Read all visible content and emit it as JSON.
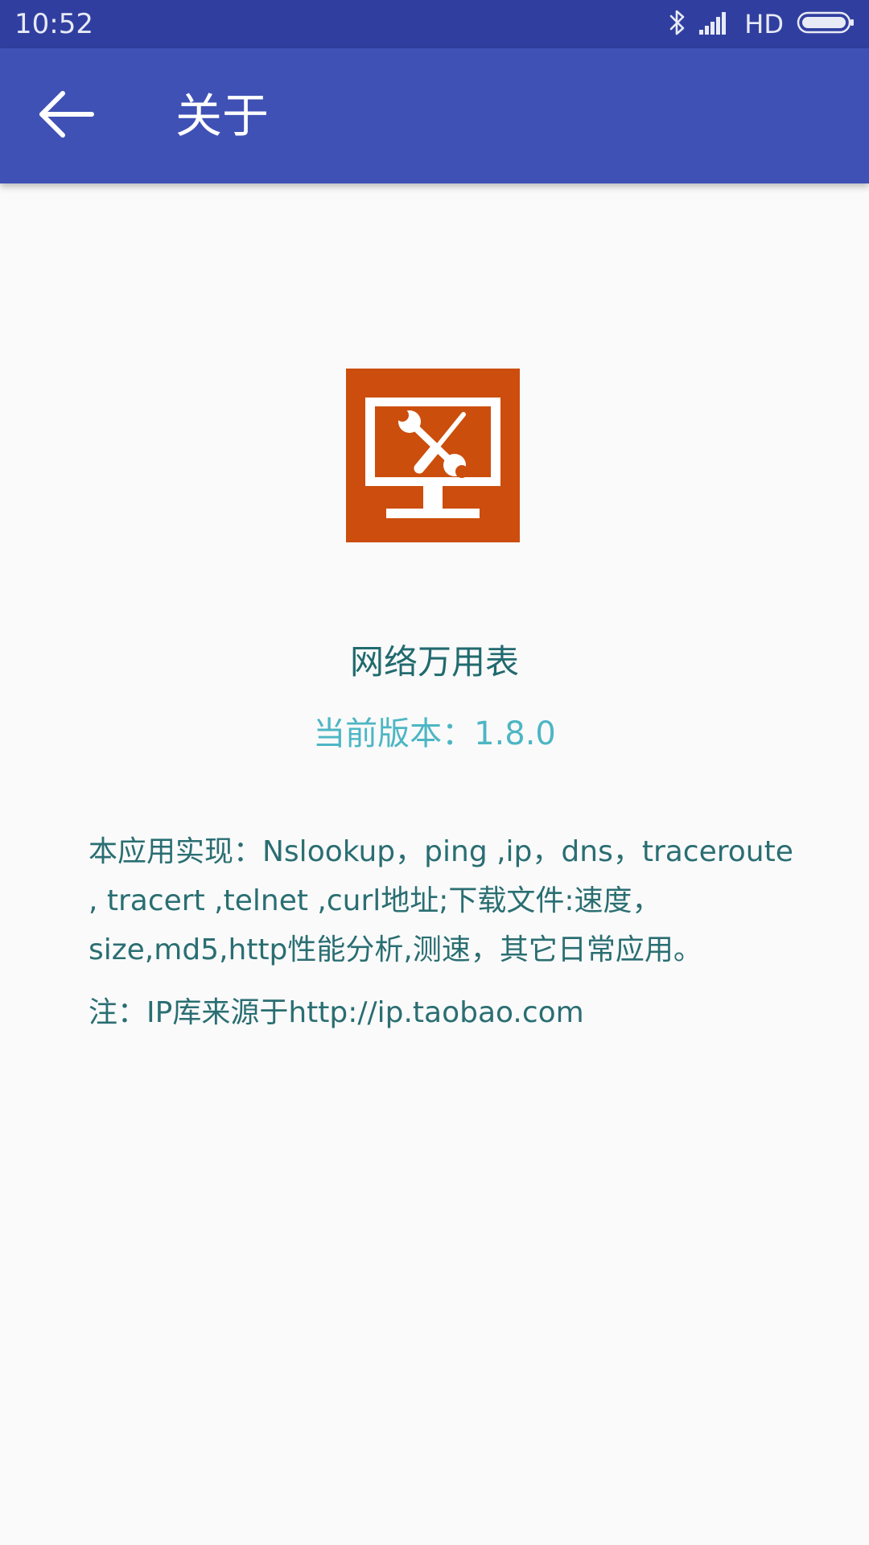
{
  "status_bar": {
    "time": "10:52",
    "network_label": "HD",
    "icons": [
      "bluetooth-icon",
      "signal-icon",
      "battery-icon"
    ]
  },
  "app_bar": {
    "back_icon": "arrow-left-icon",
    "title": "关于"
  },
  "about": {
    "logo_icon": "monitor-tools-icon",
    "app_name": "网络万用表",
    "version": "当前版本：1.8.0",
    "description": "本应用实现：Nslookup，ping ,ip，dns，traceroute , tracert ,telnet ,curl地址;下载文件:速度，size,md5,http性能分析,测速，其它日常应用。",
    "note": "注：IP库来源于http://ip.taobao.com"
  },
  "colors": {
    "status_bar": "#303f9f",
    "app_bar": "#3f51b5",
    "logo_bg": "#cc4e0c",
    "text_primary": "#216a6f",
    "text_accent": "#4db6c4"
  }
}
